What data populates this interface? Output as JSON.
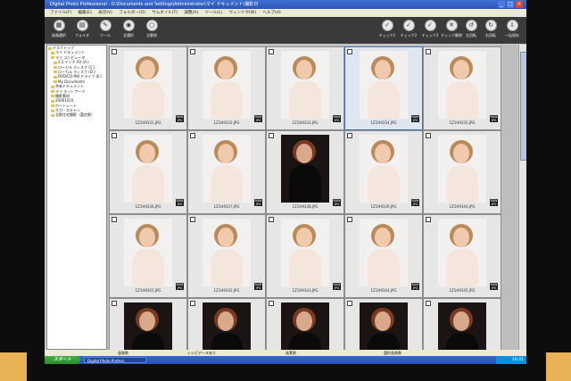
{
  "window": {
    "title": "Digital Photo Professional - D:\\Documents and Settings\\Administrator\\マイ ドキュメント\\撮影日"
  },
  "menubar": {
    "items": [
      "ファイル(F)",
      "編集(E)",
      "表示(V)",
      "フォルダー(O)",
      "サムネイル(T)",
      "調整(A)",
      "ツール(L)",
      "ウィンドウ(W)",
      "ヘルプ(H)"
    ]
  },
  "toolbar": {
    "left": [
      {
        "label": "画像選択",
        "icon": "image-select-icon"
      },
      {
        "label": "フォルダ",
        "icon": "folder-icon"
      },
      {
        "label": "ツール",
        "icon": "tool-icon"
      },
      {
        "label": "全選択",
        "icon": "select-all-icon"
      },
      {
        "label": "全解除",
        "icon": "deselect-all-icon"
      }
    ],
    "right": [
      {
        "label": "チェック1",
        "icon": "check-1-icon"
      },
      {
        "label": "チェック2",
        "icon": "check-2-icon"
      },
      {
        "label": "チェック3",
        "icon": "check-3-icon"
      },
      {
        "label": "チェック解除",
        "icon": "uncheck-icon"
      },
      {
        "label": "左回転",
        "icon": "rotate-left-icon"
      },
      {
        "label": "右回転",
        "icon": "rotate-right-icon"
      },
      {
        "label": "一括保存",
        "icon": "batch-save-icon"
      }
    ]
  },
  "tree": {
    "items": [
      "デスクトップ",
      "マイ ドキュメント",
      "マイ コンピュータ",
      "3.5 インチ FD (A:)",
      "ローカル ディスク (C:)",
      "ローカル ディスク (D:)",
      "DVD/CD-RW ドライブ (E:)",
      "My Documents",
      "共有ドキュメント",
      "マイ ネットワーク",
      "撮影素材",
      "20061010",
      "ポートレート",
      "ネガ・スキャン",
      "北欧住宅撮影（富良野）"
    ]
  },
  "thumbnails": [
    {
      "name": "1Z1H9331.JPG",
      "dark": false
    },
    {
      "name": "1Z1H9332.JPG",
      "dark": false
    },
    {
      "name": "1Z1H9333.JPG",
      "dark": false
    },
    {
      "name": "1Z1H9334.JPG",
      "dark": false
    },
    {
      "name": "1Z1H9335.JPG",
      "dark": false
    },
    {
      "name": "1Z1H9336.JPG",
      "dark": false
    },
    {
      "name": "1Z1H9337.JPG",
      "dark": false
    },
    {
      "name": "1Z1H9338.JPG",
      "dark": true
    },
    {
      "name": "1Z1H9339.JPG",
      "dark": false
    },
    {
      "name": "1Z1H9340.JPG",
      "dark": false
    },
    {
      "name": "1Z1H9341.JPG",
      "dark": false
    },
    {
      "name": "1Z1H9342.JPG",
      "dark": false
    },
    {
      "name": "1Z1H9343.JPG",
      "dark": false
    },
    {
      "name": "1Z1H9344.JPG",
      "dark": false
    },
    {
      "name": "1Z1H9345.JPG",
      "dark": false
    },
    {
      "name": "1Z1H9346.JPG",
      "dark": true
    },
    {
      "name": "1Z1H9347.JPG",
      "dark": true
    },
    {
      "name": "1Z1H9348.JPG",
      "dark": true
    },
    {
      "name": "1Z1H9349.JPG",
      "dark": true
    },
    {
      "name": "1Z1H9350.JPG",
      "dark": true
    }
  ],
  "badge": {
    "line1": "RAW",
    "line2": "JPG"
  },
  "statusbar": {
    "a": "画像数",
    "b": "レシピデータあり",
    "c": "画素数",
    "d": "選択画像数"
  },
  "taskbar": {
    "start": "スタート",
    "task": "Digital Photo Profess",
    "clock": "16:41"
  },
  "colors": {
    "titlebar": "#2a55b5",
    "toolbar": "#3a3a3a",
    "selected": "#4a6fb8",
    "start": "#2b8f2b"
  }
}
